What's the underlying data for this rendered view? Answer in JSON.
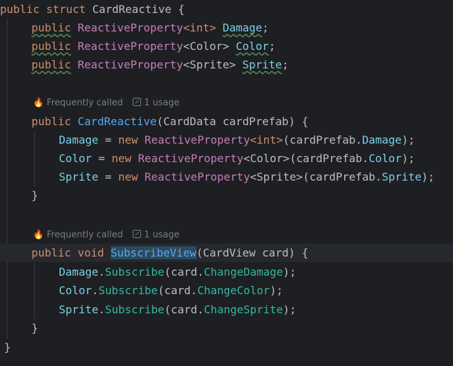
{
  "code": {
    "line1": [
      "public",
      "struct",
      "CardReactive",
      "{"
    ],
    "line2": [
      "public",
      "ReactiveProperty",
      "<int>",
      "Damage",
      ";"
    ],
    "line3": [
      "public",
      "ReactiveProperty",
      "<Color>",
      "Color",
      ";"
    ],
    "line4": [
      "public",
      "ReactiveProperty",
      "<Sprite>",
      "Sprite",
      ";"
    ],
    "line6": [
      "public",
      "CardReactive",
      "(CardData cardPrefab) {"
    ],
    "line7": [
      "Damage",
      " = ",
      "new",
      "ReactiveProperty",
      "<int>",
      "(cardPrefab.",
      "Damage",
      ");"
    ],
    "line8": [
      "Color",
      " = ",
      "new",
      "ReactiveProperty",
      "<Color>",
      "(cardPrefab.",
      "Color",
      ");"
    ],
    "line9": [
      "Sprite",
      " = ",
      "new",
      "ReactiveProperty",
      "<Sprite>",
      "(cardPrefab.",
      "Sprite",
      ");"
    ],
    "line10": [
      "}"
    ],
    "line12": [
      "public",
      "void",
      "SubscribeView",
      "(CardView card) {"
    ],
    "line13": [
      "Damage",
      ".",
      "Subscribe",
      "(card.",
      "ChangeDamage",
      ");"
    ],
    "line14": [
      "Color",
      ".",
      "Subscribe",
      "(card.",
      "ChangeColor",
      ");"
    ],
    "line15": [
      "Sprite",
      ".",
      "Subscribe",
      "(card.",
      "ChangeSprite",
      ");"
    ],
    "line16": [
      "}"
    ],
    "line17": [
      "}"
    ]
  },
  "hints": {
    "frequently_called": "Frequently called",
    "usage": "1 usage"
  },
  "icons": {
    "fire": "fire-icon",
    "usage": "usage-arrow-icon"
  },
  "colors": {
    "background": "#1e1f22",
    "keyword": "#cf8e6d",
    "type_param": "#c77dbb",
    "field": "#7bd0e8",
    "function": "#56a8f5",
    "member": "#2fbaa3"
  }
}
